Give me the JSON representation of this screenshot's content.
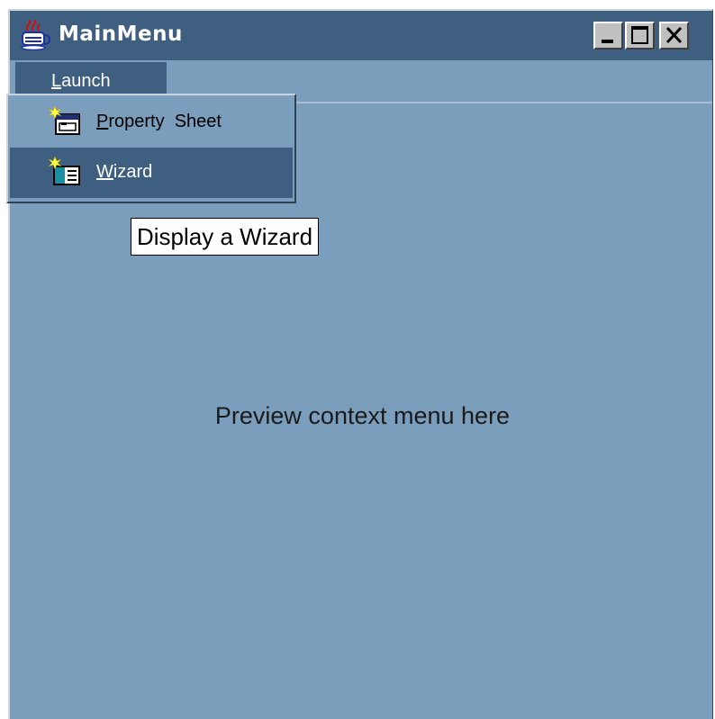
{
  "window": {
    "title": "MainMenu",
    "app_icon": "java-coffee-cup-icon",
    "controls": {
      "minimize_icon": "minimize-icon",
      "maximize_icon": "maximize-icon",
      "close_icon": "close-icon"
    }
  },
  "menubar": {
    "launch_mnemonic": "L",
    "launch_rest": "aunch"
  },
  "popup": {
    "items": [
      {
        "mnemonic": "P",
        "rest": "roperty  Sheet",
        "icon": "property-sheet-icon",
        "highlighted": false
      },
      {
        "mnemonic": "W",
        "rest": "izard",
        "icon": "wizard-icon",
        "highlighted": true
      }
    ]
  },
  "tooltip": {
    "text": "Display a Wizard"
  },
  "content": {
    "preview_text": "Preview context menu here"
  },
  "colors": {
    "background": "#7b9ebd",
    "titlebar": "#3f5f80",
    "highlight": "#3f5f80"
  }
}
